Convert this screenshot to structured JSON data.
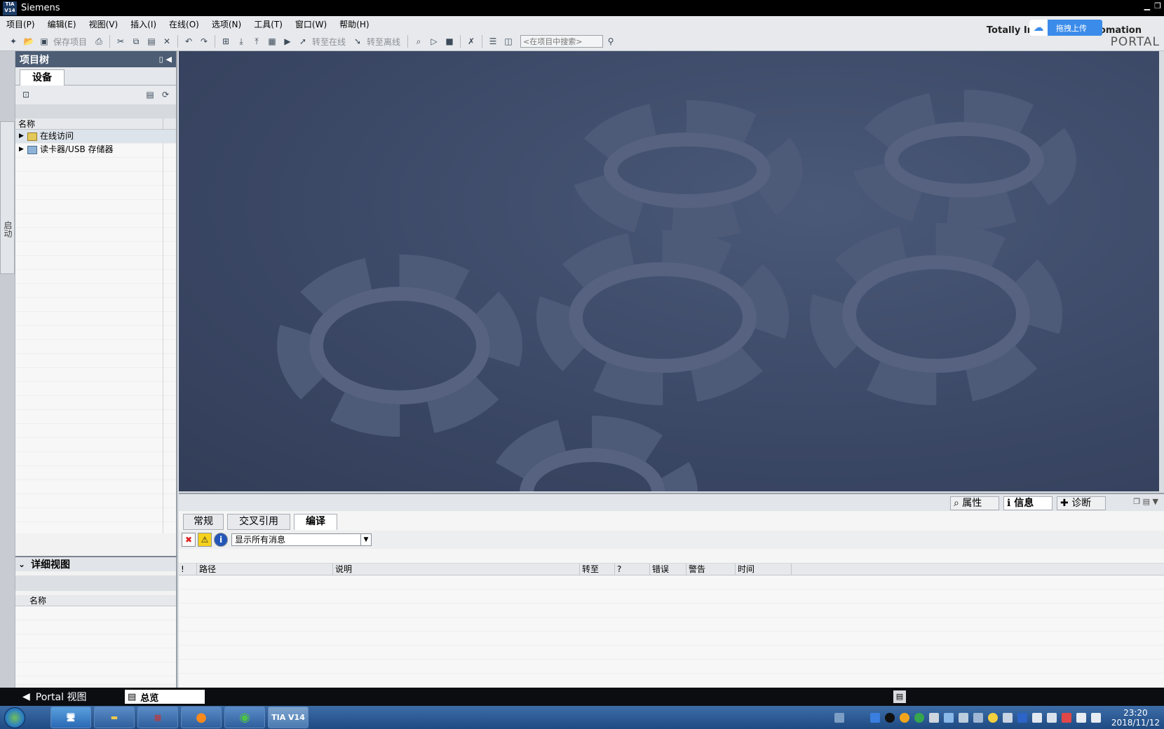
{
  "window": {
    "title": "Siemens",
    "logo_text": "TIA V14"
  },
  "menu": [
    "项目(P)",
    "编辑(E)",
    "视图(V)",
    "插入(I)",
    "在线(O)",
    "选项(N)",
    "工具(T)",
    "窗口(W)",
    "帮助(H)"
  ],
  "toolbar": {
    "save_project": "保存项目",
    "go_online": "转至在线",
    "go_offline": "转至离线",
    "search_placeholder": "<在项目中搜索>"
  },
  "brand": {
    "line1": "Totally Integrated Automation",
    "line2": "PORTAL"
  },
  "upload_widget": {
    "label": "拖拽上传"
  },
  "left_strip": {
    "tab": "启动"
  },
  "project_tree": {
    "title": "项目树",
    "tab": "设备",
    "column_name": "名称",
    "items": [
      {
        "label": "在线访问"
      },
      {
        "label": "读卡器/USB 存储器"
      }
    ]
  },
  "detail_view": {
    "title": "详细视图",
    "column_name": "名称"
  },
  "right_panel_tabs": {
    "properties": "属性",
    "info": "信息",
    "diagnostics": "诊断"
  },
  "inspector": {
    "tabs": [
      "常规",
      "交叉引用",
      "编译"
    ],
    "active_tab": "编译",
    "filter_value": "显示所有消息",
    "columns": [
      "!",
      "路径",
      "说明",
      "转至",
      "?",
      "错误",
      "警告",
      "时间"
    ]
  },
  "statusbar": {
    "portal_view": "Portal 视图",
    "overview": "总览"
  },
  "taskbar": {
    "apps": [
      "",
      "",
      "",
      "",
      "",
      "TIA V14"
    ],
    "time": "23:20",
    "date": "2018/11/12"
  }
}
